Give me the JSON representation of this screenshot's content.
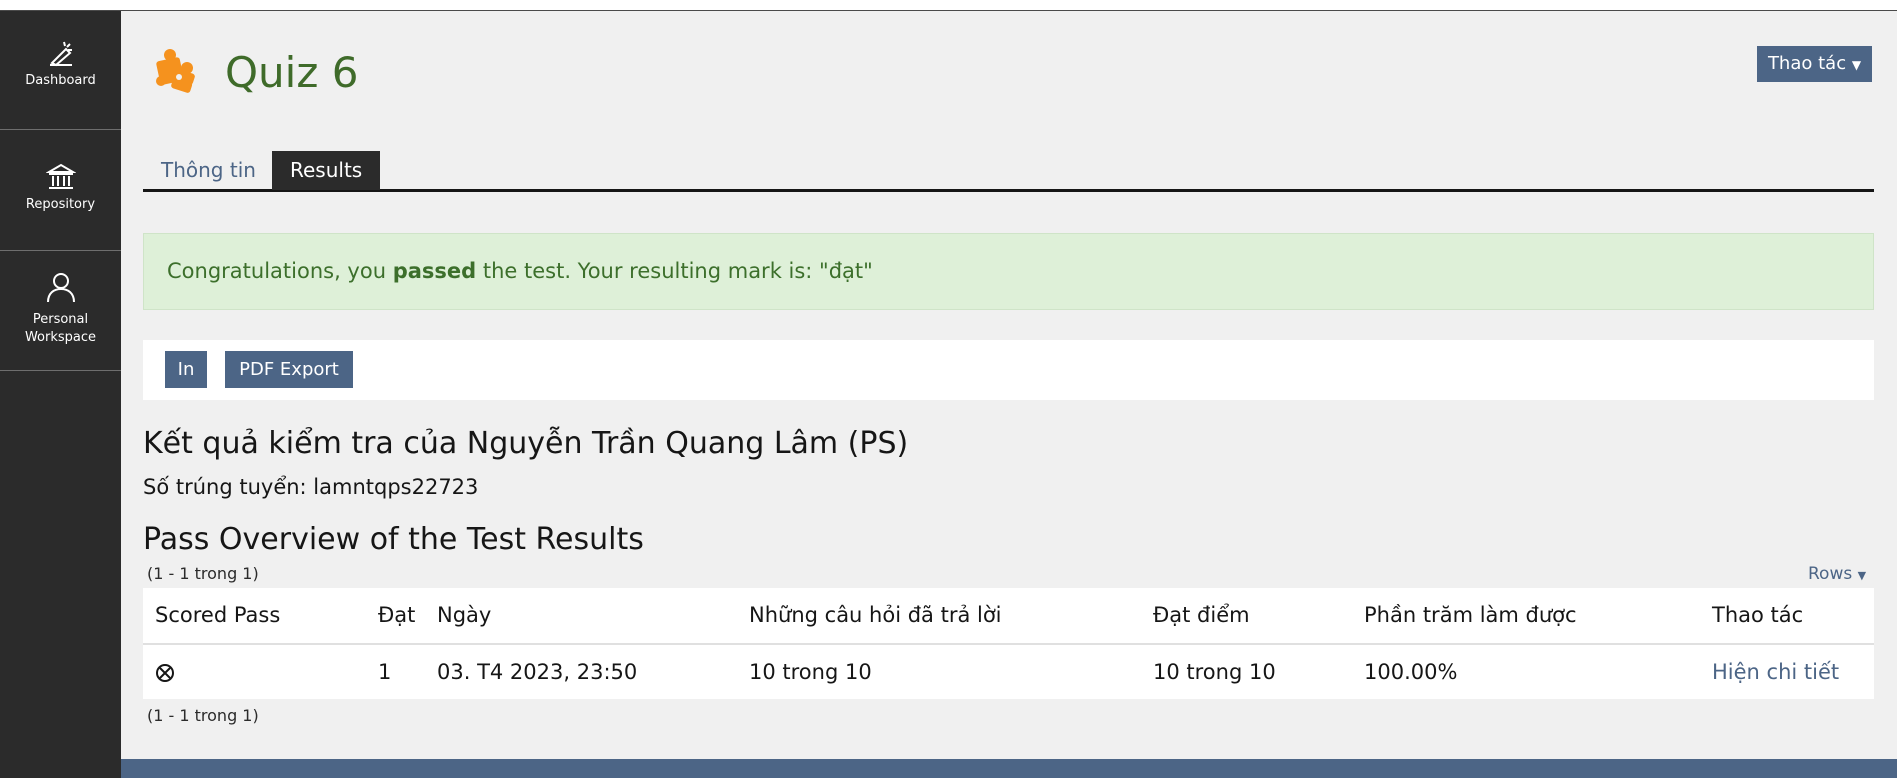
{
  "sidebar": {
    "items": [
      {
        "label": "Dashboard",
        "icon": "dashboard-icon"
      },
      {
        "label": "Repository",
        "icon": "repository-icon"
      },
      {
        "label": "Personal Workspace",
        "icon": "user-icon"
      }
    ]
  },
  "header": {
    "title": "Quiz 6",
    "title_icon": "puzzle-icon",
    "actions_label": "Thao tác"
  },
  "tabs": [
    {
      "label": "Thông tin",
      "active": false
    },
    {
      "label": "Results",
      "active": true
    }
  ],
  "alert": {
    "prefix": "Congratulations, you ",
    "bold": "passed",
    "suffix": " the test. Your resulting mark is: \"đạt\""
  },
  "toolbar": {
    "print_label": "In",
    "pdf_label": "PDF Export"
  },
  "results": {
    "heading": "Kết quả kiểm tra của Nguyễn Trần Quang Lâm (PS)",
    "student_id": "Số trúng tuyển: lamntqps22723",
    "overview_heading": "Pass Overview of the Test Results",
    "pager_top": "(1 - 1 trong 1)",
    "pager_bottom": "(1 - 1 trong 1)",
    "rows_label": "Rows"
  },
  "table": {
    "columns": [
      "Scored Pass",
      "Đạt",
      "Ngày",
      "Những câu hỏi đã trả lời",
      "Đạt điểm",
      "Phần trăm làm được",
      "Thao tác"
    ],
    "rows": [
      {
        "scored_pass_icon": "circle-x-icon",
        "pass": "1",
        "date": "03. T4 2023, 23:50",
        "answered": "10 trong 10",
        "score": "10 trong 10",
        "percent": "100.00%",
        "action": "Hiện chi tiết"
      }
    ]
  },
  "colors": {
    "sidebar_bg": "#2b2b2b",
    "accent": "#4c6586",
    "title_green": "#3f6b2a",
    "alert_bg": "#def0d8",
    "puzzle_orange": "#f5921e"
  }
}
